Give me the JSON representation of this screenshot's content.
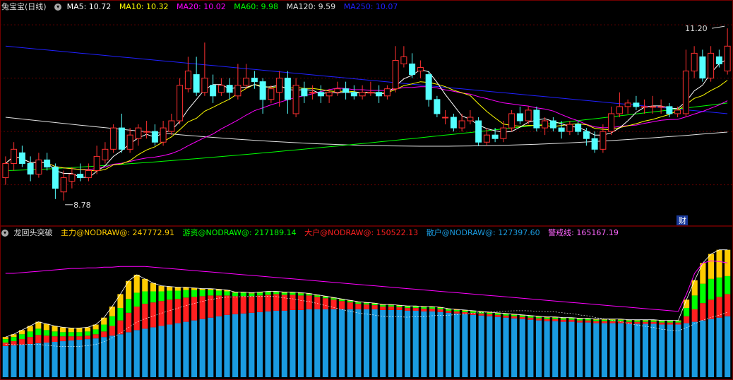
{
  "colors": {
    "ma5": "#ffffff",
    "ma10": "#ffff00",
    "ma20": "#ff00ff",
    "ma60": "#00ff00",
    "ma120": "#e0e0e0",
    "ma250": "#2020ff",
    "up": "#ff3030",
    "down": "#54ffff",
    "main": "#ffcc00",
    "hot": "#00ff00",
    "big": "#ff2020",
    "retail": "#1a9be0",
    "warn": "#ff00ff"
  },
  "top_legend": {
    "title": "兔宝宝(日线)",
    "ma5": "MA5: 10.72",
    "ma10": "MA10: 10.32",
    "ma20": "MA20: 10.02",
    "ma60": "MA60: 9.98",
    "ma120": "MA120: 9.59",
    "ma250": "MA250: 10.07"
  },
  "bottom_legend": {
    "title": "龙回头突破",
    "main": "主力@NODRAW@: 247772.91",
    "hot": "游资@NODRAW@: 217189.14",
    "big": "大户@NODRAW@: 150522.13",
    "retail": "散户@NODRAW@: 127397.60",
    "warn": "警戒线: 165167.19"
  },
  "annotations": {
    "high": "11.20",
    "low": "8.78",
    "fin": "财"
  },
  "chart_data": [
    {
      "type": "candlestick",
      "ylim": [
        8.5,
        11.4
      ],
      "high_mark": 11.2,
      "low_mark": 8.78,
      "candles": [
        [
          9.1,
          9.3,
          9.4,
          9.0
        ],
        [
          9.3,
          9.5,
          9.6,
          9.2
        ],
        [
          9.45,
          9.3,
          9.55,
          9.25
        ],
        [
          9.3,
          9.15,
          9.4,
          9.05
        ],
        [
          9.15,
          9.35,
          9.45,
          9.1
        ],
        [
          9.35,
          9.25,
          9.45,
          9.2
        ],
        [
          9.25,
          8.95,
          9.3,
          8.8
        ],
        [
          8.9,
          9.1,
          9.2,
          8.78
        ],
        [
          9.05,
          9.15,
          9.25,
          8.95
        ],
        [
          9.15,
          9.1,
          9.3,
          9.05
        ],
        [
          9.1,
          9.2,
          9.3,
          9.05
        ],
        [
          9.2,
          9.4,
          9.55,
          9.15
        ],
        [
          9.35,
          9.5,
          9.6,
          9.3
        ],
        [
          9.5,
          9.8,
          9.85,
          9.45
        ],
        [
          9.8,
          9.5,
          10.0,
          9.45
        ],
        [
          9.5,
          9.7,
          9.8,
          9.45
        ],
        [
          9.65,
          9.8,
          9.85,
          9.55
        ],
        [
          9.75,
          9.75,
          9.9,
          9.65
        ],
        [
          9.75,
          9.6,
          9.85,
          9.55
        ],
        [
          9.6,
          9.8,
          9.9,
          9.55
        ],
        [
          9.75,
          9.9,
          10.0,
          9.7
        ],
        [
          9.9,
          10.4,
          10.5,
          9.85
        ],
        [
          10.35,
          10.6,
          10.8,
          10.3
        ],
        [
          10.55,
          10.3,
          10.8,
          10.25
        ],
        [
          10.3,
          10.5,
          11.0,
          10.25
        ],
        [
          10.4,
          10.25,
          10.55,
          10.15
        ],
        [
          10.3,
          10.4,
          10.5,
          10.25
        ],
        [
          10.4,
          10.3,
          10.5,
          10.2
        ],
        [
          10.25,
          10.4,
          10.7,
          10.2
        ],
        [
          10.4,
          10.5,
          10.7,
          10.35
        ],
        [
          10.5,
          10.45,
          10.6,
          10.35
        ],
        [
          10.45,
          10.2,
          10.5,
          10.0
        ],
        [
          10.2,
          10.35,
          10.4,
          10.15
        ],
        [
          10.3,
          10.5,
          10.6,
          10.1
        ],
        [
          10.5,
          10.2,
          10.6,
          10.0
        ],
        [
          10.0,
          10.4,
          10.5,
          9.95
        ],
        [
          10.35,
          10.25,
          10.45,
          10.15
        ],
        [
          10.3,
          10.3,
          10.4,
          10.2
        ],
        [
          10.3,
          10.25,
          10.4,
          10.15
        ],
        [
          10.25,
          10.3,
          10.35,
          10.15
        ],
        [
          10.3,
          10.35,
          10.45,
          10.25
        ],
        [
          10.35,
          10.3,
          10.45,
          10.2
        ],
        [
          10.3,
          10.25,
          10.4,
          10.2
        ],
        [
          10.25,
          10.3,
          10.4,
          10.2
        ],
        [
          10.3,
          10.3,
          10.45,
          10.25
        ],
        [
          10.3,
          10.25,
          10.4,
          10.15
        ],
        [
          10.25,
          10.35,
          10.4,
          10.2
        ],
        [
          10.35,
          10.75,
          10.95,
          10.3
        ],
        [
          10.7,
          10.8,
          10.95,
          10.65
        ],
        [
          10.7,
          10.55,
          10.85,
          10.5
        ],
        [
          10.6,
          10.65,
          10.75,
          10.5
        ],
        [
          10.55,
          10.2,
          10.6,
          10.1
        ],
        [
          10.2,
          10.0,
          10.25,
          9.95
        ],
        [
          9.95,
          9.95,
          10.05,
          9.85
        ],
        [
          9.95,
          9.8,
          10.0,
          9.75
        ],
        [
          9.8,
          9.9,
          10.0,
          9.75
        ],
        [
          9.9,
          9.95,
          10.05,
          9.85
        ],
        [
          9.9,
          9.6,
          9.95,
          9.55
        ],
        [
          9.6,
          9.7,
          9.8,
          9.55
        ],
        [
          9.7,
          9.65,
          9.8,
          9.6
        ],
        [
          9.65,
          9.8,
          9.9,
          9.6
        ],
        [
          9.8,
          10.0,
          10.05,
          9.75
        ],
        [
          10.0,
          9.9,
          10.1,
          9.85
        ],
        [
          9.9,
          10.05,
          10.1,
          9.85
        ],
        [
          10.05,
          9.8,
          10.1,
          9.75
        ],
        [
          9.8,
          9.9,
          9.95,
          9.7
        ],
        [
          9.9,
          9.8,
          9.95,
          9.75
        ],
        [
          9.8,
          9.75,
          9.9,
          9.65
        ],
        [
          9.75,
          9.85,
          9.9,
          9.7
        ],
        [
          9.85,
          9.75,
          9.9,
          9.7
        ],
        [
          9.75,
          9.65,
          9.8,
          9.55
        ],
        [
          9.65,
          9.5,
          9.75,
          9.45
        ],
        [
          9.5,
          9.75,
          9.85,
          9.45
        ],
        [
          9.75,
          10.0,
          10.1,
          9.7
        ],
        [
          10.0,
          10.1,
          10.3,
          9.95
        ],
        [
          10.1,
          10.15,
          10.2,
          10.0
        ],
        [
          10.15,
          10.1,
          10.25,
          10.05
        ],
        [
          10.1,
          10.1,
          10.2,
          10.0
        ],
        [
          10.1,
          10.1,
          10.25,
          10.0
        ],
        [
          10.1,
          10.1,
          10.2,
          10.0
        ],
        [
          10.1,
          10.0,
          10.15,
          9.95
        ],
        [
          10.0,
          10.05,
          10.1,
          9.95
        ],
        [
          10.0,
          10.6,
          10.9,
          9.95
        ],
        [
          10.6,
          10.85,
          10.95,
          10.5
        ],
        [
          10.8,
          10.5,
          10.9,
          10.45
        ],
        [
          10.5,
          10.85,
          10.95,
          10.45
        ],
        [
          10.8,
          10.7,
          10.9,
          10.65
        ],
        [
          10.6,
          10.95,
          11.2,
          10.55
        ]
      ]
    },
    {
      "type": "stacked-bar",
      "ylim": [
        0,
        200
      ],
      "retail": [
        45,
        46,
        47,
        48,
        49,
        50,
        51,
        52,
        53,
        54,
        55,
        56,
        58,
        60,
        62,
        65,
        68,
        70,
        72,
        74,
        76,
        78,
        80,
        82,
        84,
        86,
        88,
        90,
        91,
        92,
        93,
        94,
        95,
        96,
        96,
        97,
        97,
        98,
        98,
        98,
        98,
        98,
        98,
        98,
        98,
        98,
        97,
        97,
        97,
        96,
        96,
        95,
        95,
        94,
        93,
        92,
        91,
        90,
        89,
        88,
        87,
        86,
        85,
        84,
        83,
        82,
        81,
        81,
        80,
        80,
        79,
        79,
        78,
        78,
        78,
        78,
        77,
        77,
        77,
        77,
        76,
        76,
        76,
        78,
        80,
        82,
        84,
        86,
        88
      ],
      "big": [
        5,
        6,
        8,
        10,
        12,
        10,
        8,
        7,
        6,
        5,
        5,
        6,
        8,
        14,
        20,
        28,
        34,
        36,
        36,
        36,
        36,
        35,
        35,
        34,
        33,
        32,
        30,
        28,
        26,
        25,
        24,
        24,
        24,
        24,
        23,
        22,
        21,
        20,
        18,
        16,
        14,
        12,
        10,
        8,
        7,
        6,
        5,
        5,
        4,
        4,
        4,
        4,
        4,
        4,
        3,
        3,
        3,
        3,
        3,
        3,
        3,
        3,
        3,
        3,
        3,
        3,
        3,
        3,
        3,
        3,
        3,
        3,
        3,
        3,
        3,
        3,
        3,
        3,
        3,
        3,
        3,
        3,
        3,
        10,
        18,
        25,
        28,
        30,
        32
      ],
      "hot": [
        5,
        6,
        7,
        8,
        9,
        8,
        7,
        6,
        6,
        6,
        6,
        7,
        10,
        14,
        18,
        20,
        20,
        18,
        16,
        14,
        13,
        12,
        11,
        10,
        9,
        8,
        7,
        6,
        5,
        5,
        4,
        4,
        4,
        3,
        3,
        3,
        3,
        2,
        2,
        2,
        2,
        2,
        2,
        2,
        2,
        2,
        2,
        2,
        2,
        2,
        2,
        2,
        2,
        2,
        2,
        2,
        2,
        2,
        2,
        2,
        2,
        2,
        2,
        2,
        2,
        2,
        2,
        2,
        2,
        2,
        2,
        2,
        2,
        2,
        2,
        2,
        2,
        2,
        2,
        2,
        2,
        2,
        2,
        12,
        20,
        28,
        30,
        28,
        26
      ],
      "main": [
        3,
        4,
        6,
        8,
        10,
        9,
        8,
        7,
        6,
        6,
        6,
        7,
        10,
        14,
        20,
        26,
        26,
        18,
        12,
        8,
        6,
        5,
        4,
        3,
        2,
        2,
        2,
        2,
        1,
        1,
        1,
        1,
        1,
        1,
        1,
        1,
        1,
        1,
        1,
        1,
        1,
        1,
        1,
        1,
        1,
        1,
        1,
        1,
        1,
        1,
        1,
        1,
        1,
        1,
        1,
        1,
        1,
        1,
        1,
        1,
        1,
        1,
        1,
        1,
        1,
        1,
        1,
        1,
        1,
        1,
        1,
        1,
        1,
        1,
        1,
        1,
        1,
        1,
        1,
        1,
        1,
        1,
        1,
        12,
        22,
        30,
        36,
        40,
        38
      ],
      "warn": [
        150,
        150,
        151,
        152,
        153,
        154,
        155,
        156,
        157,
        157,
        158,
        158,
        159,
        159,
        160,
        160,
        160,
        160,
        159,
        158,
        157,
        156,
        155,
        154,
        153,
        152,
        151,
        150,
        149,
        148,
        147,
        146,
        145,
        144,
        143,
        142,
        141,
        140,
        139,
        138,
        137,
        136,
        135,
        134,
        133,
        132,
        131,
        130,
        129,
        128,
        127,
        126,
        125,
        124,
        123,
        122,
        121,
        120,
        119,
        118,
        117,
        116,
        115,
        114,
        113,
        112,
        111,
        110,
        109,
        108,
        107,
        106,
        105,
        104,
        103,
        102,
        101,
        100,
        99,
        98,
        97,
        96,
        95,
        120,
        150,
        165,
        168,
        167,
        165
      ]
    }
  ]
}
